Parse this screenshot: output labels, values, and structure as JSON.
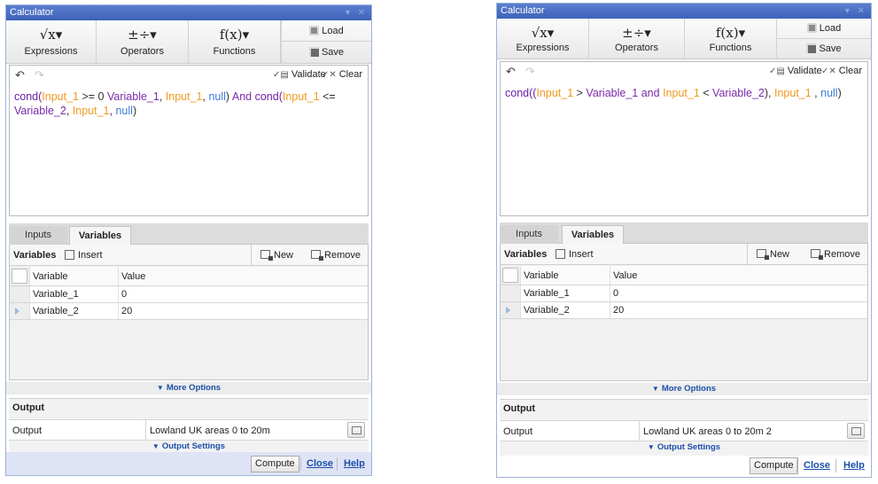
{
  "left": {
    "title": "Calculator",
    "ribbon": {
      "expressions": "Expressions",
      "operators": "Operators",
      "functions": "Functions",
      "load": "Load",
      "save": "Save"
    },
    "editor": {
      "validate": "Validate",
      "clear": "Clear"
    },
    "expression_tokens": [
      {
        "t": "cond(",
        "k": "fn"
      },
      {
        "t": "Input_1",
        "k": "in"
      },
      {
        "t": " >= 0 ",
        "k": "op"
      },
      {
        "t": "Variable_1",
        "k": "var"
      },
      {
        "t": ", ",
        "k": "op"
      },
      {
        "t": "Input_1",
        "k": "in"
      },
      {
        "t": ", ",
        "k": "op"
      },
      {
        "t": "null",
        "k": "nul"
      },
      {
        "t": ") ",
        "k": "op"
      },
      {
        "t": "And ",
        "k": "kw"
      },
      {
        "t": "cond(",
        "k": "fn"
      },
      {
        "t": "Input_1",
        "k": "in"
      },
      {
        "t": " <= ",
        "k": "op"
      },
      {
        "t": "Variable_2",
        "k": "var"
      },
      {
        "t": ", ",
        "k": "op"
      },
      {
        "t": "Input_1",
        "k": "in"
      },
      {
        "t": ", ",
        "k": "op"
      },
      {
        "t": "null",
        "k": "nul"
      },
      {
        "t": ")",
        "k": "op"
      }
    ],
    "tabs": [
      "Inputs",
      "Variables"
    ],
    "variables_toolbar": {
      "title": "Variables",
      "insert": "Insert",
      "new": "New",
      "remove": "Remove"
    },
    "grid": {
      "headers": [
        "Variable",
        "Value"
      ],
      "rows": [
        [
          "Variable_1",
          "0"
        ],
        [
          "Variable_2",
          "20"
        ]
      ]
    },
    "more_options": "More Options",
    "output": {
      "heading": "Output",
      "label": "Output",
      "value": "Lowland UK areas 0 to 20m",
      "settings": "Output Settings"
    },
    "footer": {
      "compute": "Compute",
      "close": "Close",
      "help": "Help"
    }
  },
  "right": {
    "title": "Calculator",
    "ribbon": {
      "expressions": "Expressions",
      "operators": "Operators",
      "functions": "Functions",
      "load": "Load",
      "save": "Save"
    },
    "editor": {
      "validate": "Validate",
      "clear": "Clear"
    },
    "expression_tokens": [
      {
        "t": "cond((",
        "k": "fn"
      },
      {
        "t": "Input_1",
        "k": "in"
      },
      {
        "t": " > ",
        "k": "op"
      },
      {
        "t": "Variable_1",
        "k": "var"
      },
      {
        "t": " and ",
        "k": "kw"
      },
      {
        "t": "Input_1",
        "k": "in"
      },
      {
        "t": " < ",
        "k": "op"
      },
      {
        "t": "Variable_2",
        "k": "var"
      },
      {
        "t": "), ",
        "k": "op"
      },
      {
        "t": "Input_1",
        "k": "in"
      },
      {
        "t": " , ",
        "k": "op"
      },
      {
        "t": "null",
        "k": "nul"
      },
      {
        "t": ")",
        "k": "op"
      }
    ],
    "tabs": [
      "Inputs",
      "Variables"
    ],
    "variables_toolbar": {
      "title": "Variables",
      "insert": "Insert",
      "new": "New",
      "remove": "Remove"
    },
    "grid": {
      "headers": [
        "Variable",
        "Value"
      ],
      "rows": [
        [
          "Variable_1",
          "0"
        ],
        [
          "Variable_2",
          "20"
        ]
      ]
    },
    "more_options": "More Options",
    "output": {
      "heading": "Output",
      "label": "Output",
      "value": "Lowland UK areas 0 to 20m 2",
      "settings": "Output Settings"
    },
    "footer": {
      "compute": "Compute",
      "close": "Close",
      "help": "Help"
    }
  },
  "colors": {
    "titlebar": "#3d62b8",
    "function_token": "#6a1fa8",
    "input_token": "#ef9a1f",
    "variable_token": "#7a2aa8",
    "null_token": "#3d7bd9",
    "link": "#1b4fa8"
  },
  "icons": [
    "sqrt-x-icon",
    "operators-icon",
    "function-icon",
    "load-icon",
    "save-icon",
    "undo-icon",
    "redo-icon",
    "validate-icon",
    "clear-icon",
    "insert-icon",
    "new-icon",
    "remove-icon",
    "browse-icon",
    "row-pointer-icon"
  ]
}
